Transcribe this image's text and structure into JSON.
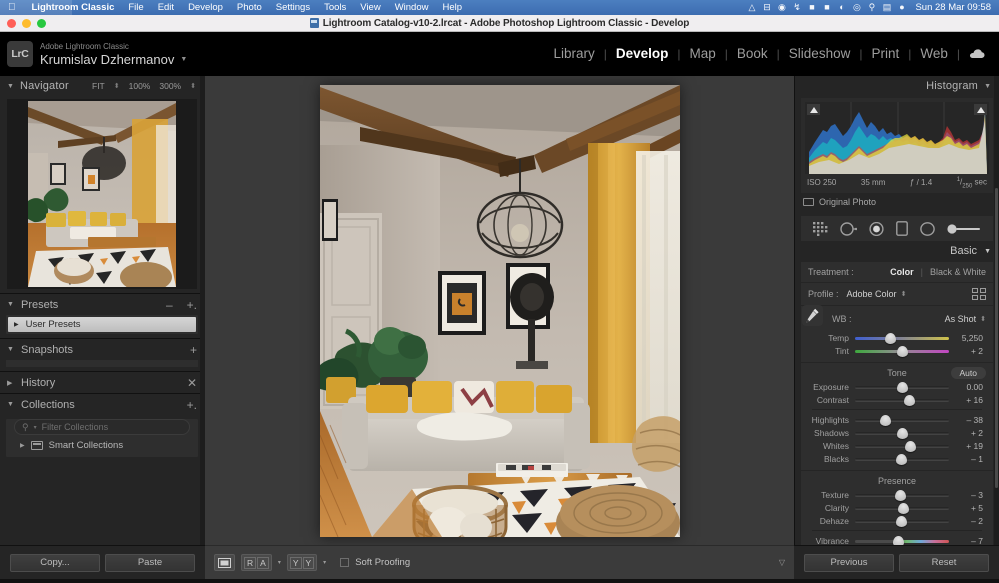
{
  "menubar": {
    "apple_icon": "apple-icon",
    "items": [
      {
        "label": "Lightroom Classic",
        "bold": true
      },
      {
        "label": "File",
        "bold": false
      },
      {
        "label": "Edit",
        "bold": false
      },
      {
        "label": "Develop",
        "bold": false
      },
      {
        "label": "Photo",
        "bold": false
      },
      {
        "label": "Settings",
        "bold": false
      },
      {
        "label": "Tools",
        "bold": false
      },
      {
        "label": "View",
        "bold": false
      },
      {
        "label": "Window",
        "bold": false
      },
      {
        "label": "Help",
        "bold": false
      }
    ],
    "status_icons": [
      "circle-arrow-icon",
      "minus-box-icon",
      "spinner-icon",
      "bluetooth-icon",
      "flag-uk-icon",
      "battery-charging-icon",
      "wifi-icon",
      "user-account-icon",
      "search-icon",
      "control-center-icon",
      "siri-icon"
    ],
    "clock": "Sun 28 Mar  09:58"
  },
  "titlebar": {
    "title": "Lightroom Catalog-v10-2.lrcat - Adobe Photoshop Lightroom Classic - Develop",
    "doc_icon": "catalog-file-icon",
    "close": "close-button",
    "minimize": "minimize-button",
    "zoom": "zoom-button"
  },
  "identity": {
    "badge": "LrC",
    "app_name": "Adobe Lightroom Classic",
    "user_name": "Krumislav Dzhermanov",
    "caret": "▼"
  },
  "modules": {
    "items": [
      {
        "label": "Library",
        "active": false
      },
      {
        "label": "Develop",
        "active": true
      },
      {
        "label": "Map",
        "active": false
      },
      {
        "label": "Book",
        "active": false
      },
      {
        "label": "Slideshow",
        "active": false
      },
      {
        "label": "Print",
        "active": false
      },
      {
        "label": "Web",
        "active": false
      }
    ],
    "separator": "|",
    "cloud_icon": "cloud-icon"
  },
  "navigator": {
    "title": "Navigator",
    "triangle": "▼",
    "zoom_levels": [
      "FIT",
      "100%",
      "300%"
    ],
    "stepper": "⬍"
  },
  "left_sections": [
    {
      "title": "Presets",
      "triangle": "▼",
      "expanded": true,
      "minus": "–",
      "plus": "+."
    },
    {
      "title": "Snapshots",
      "triangle": "▼",
      "expanded": true,
      "plus": "+"
    },
    {
      "title": "History",
      "triangle": "▶",
      "expanded": false,
      "close": "✕"
    },
    {
      "title": "Collections",
      "triangle": "▼",
      "expanded": true,
      "plus": "+."
    }
  ],
  "presets": {
    "user_presets_label": "User Presets",
    "triangle": "▶"
  },
  "collections": {
    "filter_placeholder": "Filter Collections",
    "search_icon": "search-icon",
    "search_caret": "▾",
    "items": [
      {
        "label": "Smart Collections",
        "triangle": "▶",
        "icon": "smart-collection-icon"
      }
    ]
  },
  "bottom_left_buttons": [
    {
      "label": "Copy..."
    },
    {
      "label": "Paste"
    }
  ],
  "histogram": {
    "title": "Histogram",
    "triangle": "▼",
    "clip_left": "shadow-clipping-toggle",
    "clip_right": "highlight-clipping-toggle",
    "iso": "ISO 250",
    "focal": "35 mm",
    "aperture": "ƒ / 1.4",
    "shutter_num": "1",
    "shutter_den": "250",
    "shutter_unit": "sec",
    "original_photo_label": "Original Photo"
  },
  "toolstrip": {
    "tools": [
      {
        "name": "crop-overlay-tool",
        "glyph": "crop"
      },
      {
        "name": "spot-removal-tool",
        "glyph": "spot"
      },
      {
        "name": "red-eye-correction-tool",
        "glyph": "redeye"
      },
      {
        "name": "masking-rectangle-tool",
        "glyph": "rect"
      },
      {
        "name": "radial-filter-tool",
        "glyph": "radial"
      },
      {
        "name": "graduated-filter-tool",
        "glyph": "grad"
      }
    ]
  },
  "basic": {
    "title": "Basic",
    "triangle": "▼",
    "treatment_label": "Treatment :",
    "treatment_options": [
      {
        "label": "Color",
        "active": true
      },
      {
        "label": "Black & White",
        "active": false
      }
    ],
    "treatment_separator": "|",
    "profile_label": "Profile :",
    "profile_value": "Adobe Color",
    "profile_stepper": "⬍",
    "profile_browse_icon": "profile-browser-icon",
    "wb_label": "WB :",
    "wb_value": "As Shot",
    "wb_stepper": "⬍",
    "eyedropper_icon": "white-balance-selector-icon",
    "wb_sliders": [
      {
        "label": "Temp",
        "value": "5,250",
        "pos": 38,
        "track": "temp"
      },
      {
        "label": "Tint",
        "value": "+ 2",
        "pos": 51,
        "track": "tint"
      }
    ],
    "tone_title": "Tone",
    "auto_label": "Auto",
    "tone_sliders": [
      {
        "label": "Exposure",
        "value": "0.00",
        "pos": 50,
        "track": "plain"
      },
      {
        "label": "Contrast",
        "value": "+ 16",
        "pos": 58,
        "track": "plain"
      }
    ],
    "tone_sliders2": [
      {
        "label": "Highlights",
        "value": "– 38",
        "pos": 32,
        "track": "plain"
      },
      {
        "label": "Shadows",
        "value": "+ 2",
        "pos": 51,
        "track": "plain"
      },
      {
        "label": "Whites",
        "value": "+ 19",
        "pos": 59,
        "track": "plain"
      },
      {
        "label": "Blacks",
        "value": "– 1",
        "pos": 49,
        "track": "plain"
      }
    ],
    "presence_title": "Presence",
    "presence_sliders": [
      {
        "label": "Texture",
        "value": "– 3",
        "pos": 48,
        "track": "plain"
      },
      {
        "label": "Clarity",
        "value": "+ 5",
        "pos": 52,
        "track": "plain"
      },
      {
        "label": "Dehaze",
        "value": "– 2",
        "pos": 49,
        "track": "plain"
      },
      {
        "label": "Vibrance",
        "value": "– 7",
        "pos": 46,
        "track": "vib"
      }
    ]
  },
  "toolbar": {
    "loupe_view": "loupe-view-button",
    "before_after_label": "R|A",
    "before_after_left": "R",
    "before_after_right": "A",
    "yy_left": "Y",
    "yy_right": "Y",
    "caret": "▾",
    "soft_proofing_label": "Soft Proofing",
    "panel_caret": "▽"
  },
  "bottom_right_buttons": [
    {
      "label": "Previous"
    },
    {
      "label": "Reset"
    }
  ],
  "photo": {
    "alt": "Attic living room with exposed wooden beams, grey sofa with yellow cushions, wooden coffee table, black and white geometric rug, wicker basket and jute pouf"
  },
  "colors": {
    "panel_bg": "#252525",
    "center_bg": "#3a3a3a",
    "accent_text": "#ffffff",
    "menubar_blue": "#3c6cb0"
  }
}
